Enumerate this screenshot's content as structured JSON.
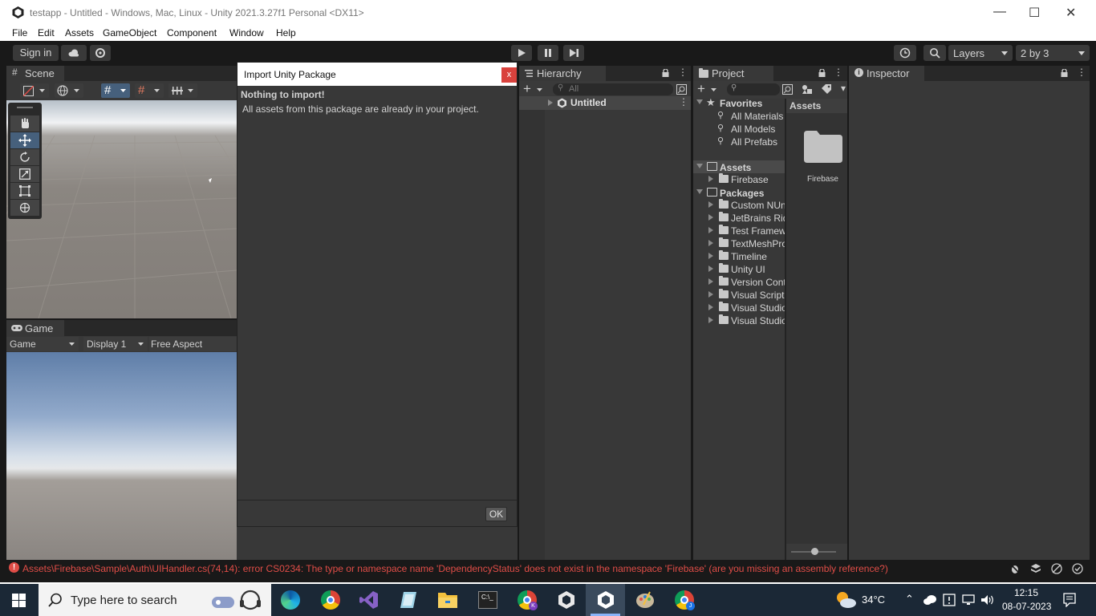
{
  "window": {
    "title": "testapp - Untitled - Windows, Mac, Linux - Unity 2021.3.27f1 Personal <DX11>",
    "minimize": "—",
    "maximize": "☐",
    "close": "✕"
  },
  "menu": [
    "File",
    "Edit",
    "Assets",
    "GameObject",
    "Component",
    "Window",
    "Help"
  ],
  "toolbar": {
    "sign_in": "Sign in",
    "layers": "Layers",
    "layout": "2 by 3"
  },
  "scene": {
    "tab": "Scene"
  },
  "game": {
    "tab": "Game",
    "view_select": "Game",
    "display_select": "Display 1",
    "aspect_select": "Free Aspect"
  },
  "dialog": {
    "title": "Import Unity Package",
    "close_label": "x",
    "heading": "Nothing to import!",
    "message": "All assets from this package are already in your project.",
    "ok_label": "OK"
  },
  "hierarchy": {
    "tab": "Hierarchy",
    "search_placeholder": "All",
    "root": "Untitled"
  },
  "project": {
    "tab": "Project",
    "favorites_label": "Favorites",
    "favorites": [
      "All Materials",
      "All Models",
      "All Prefabs"
    ],
    "assets_label": "Assets",
    "assets_children": [
      "Firebase"
    ],
    "packages_label": "Packages",
    "packages": [
      "Custom NUnit",
      "JetBrains Rider",
      "Test Framework",
      "TextMeshPro",
      "Timeline",
      "Unity UI",
      "Version Control",
      "Visual Scripting",
      "Visual Studio",
      "Visual Studio"
    ],
    "right_header": "Assets",
    "right_items": [
      "Firebase"
    ]
  },
  "inspector": {
    "tab": "Inspector"
  },
  "console": {
    "error": "Assets\\Firebase\\Sample\\Auth\\UIHandler.cs(74,14): error CS0234: The type or namespace name 'DependencyStatus' does not exist in the namespace 'Firebase' (are you missing an assembly reference?)"
  },
  "taskbar": {
    "search_placeholder": "Type here to search",
    "weather": "34°C",
    "time": "12:15",
    "date": "08-07-2023"
  },
  "colors": {
    "accent": "#3a79bb",
    "error": "#e04d47",
    "panel": "#383838",
    "taskbar": "#1b2836"
  }
}
